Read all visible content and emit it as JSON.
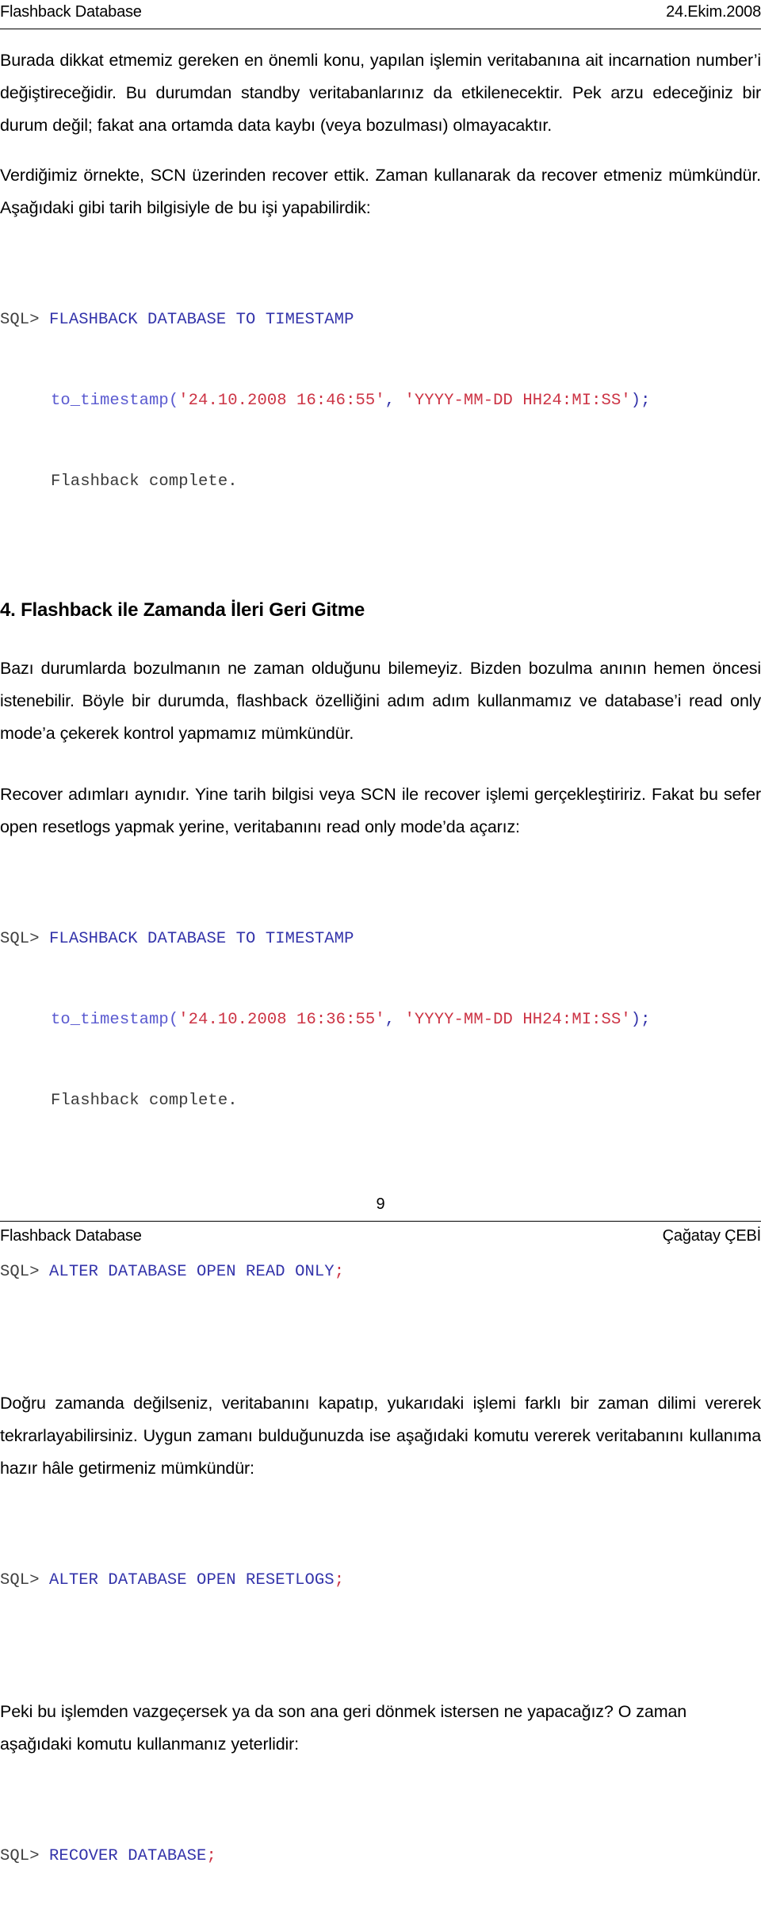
{
  "header": {
    "left": "Flashback Database",
    "right": "24.Ekim.2008"
  },
  "body": {
    "para1": "Burada dikkat etmemiz gereken en önemli konu, yapılan işlemin veritabanına ait incarnation number’i değiştireceğidir. Bu durumdan standby veritabanlarınız da etkilenecektir. Pek arzu edeceğiniz bir durum değil; fakat ana ortamda data kaybı (veya bozulması) olmayacaktır.",
    "para2": "Verdiğimiz örnekte, SCN üzerinden recover ettik. Zaman kullanarak da recover etmeniz mümkündür. Aşağıdaki gibi tarih bilgisiyle de bu işi yapabilirdik:",
    "heading": "4. Flashback ile Zamanda İleri Geri Gitme",
    "para3": "Bazı durumlarda bozulmanın ne zaman olduğunu bilemeyiz. Bizden bozulma anının hemen öncesi istenebilir. Böyle bir durumda, flashback özelliğini adım adım kullanmamız ve database’i read only mode’a çekerek kontrol yapmamız mümkündür.",
    "para4": "Recover adımları aynıdır. Yine tarih bilgisi veya SCN ile recover işlemi gerçekleştiririz. Fakat bu sefer open resetlogs yapmak yerine, veritabanını read only mode’da açarız:",
    "para5": "Doğru zamanda değilseniz, veritabanını kapatıp, yukarıdaki işlemi farklı bir zaman dilimi vererek tekrarlayabilirsiniz. Uygun zamanı bulduğunuzda ise aşağıdaki komutu vererek veritabanını kullanıma hazır hâle getirmeniz mümkündür:",
    "para6": "Peki bu işlemden vazgeçersek ya da son ana geri dönmek istersen ne yapacağız? O zaman aşağıdaki komutu kullanmanız yeterlidir:"
  },
  "code_blocks": {
    "block1": {
      "line1_prompt": "SQL> ",
      "line1_kw": "FLASHBACK DATABASE TO TIMESTAMP",
      "line2_fn": "to_timestamp(",
      "line2_str1": "'24.10.2008 16:46:55'",
      "line2_comma": ", ",
      "line2_str2": "'YYYY-MM-DD HH24:MI:SS'",
      "line2_end": ");",
      "line3_out": "Flashback complete."
    },
    "block2": {
      "line1_prompt": "SQL> ",
      "line1_kw": "FLASHBACK DATABASE TO TIMESTAMP",
      "line2_fn": "to_timestamp(",
      "line2_str1": "'24.10.2008 16:36:55'",
      "line2_comma": ", ",
      "line2_str2": "'YYYY-MM-DD HH24:MI:SS'",
      "line2_end": ");",
      "line3_out": "Flashback complete."
    },
    "block3": {
      "prompt": "SQL> ",
      "kw": "ALTER DATABASE OPEN READ ONLY",
      "end": ";"
    },
    "block4": {
      "prompt": "SQL> ",
      "kw": "ALTER DATABASE OPEN RESETLOGS",
      "end": ";"
    },
    "block5": {
      "prompt": "SQL> ",
      "kw": "RECOVER DATABASE",
      "end": ";"
    }
  },
  "footer": {
    "page_number": "9",
    "left": "Flashback Database",
    "right": "Çağatay ÇEBİ"
  },
  "colors": {
    "keyword": "#3333aa",
    "string": "#cc3344",
    "prompt": "#404040",
    "text": "#000000"
  }
}
